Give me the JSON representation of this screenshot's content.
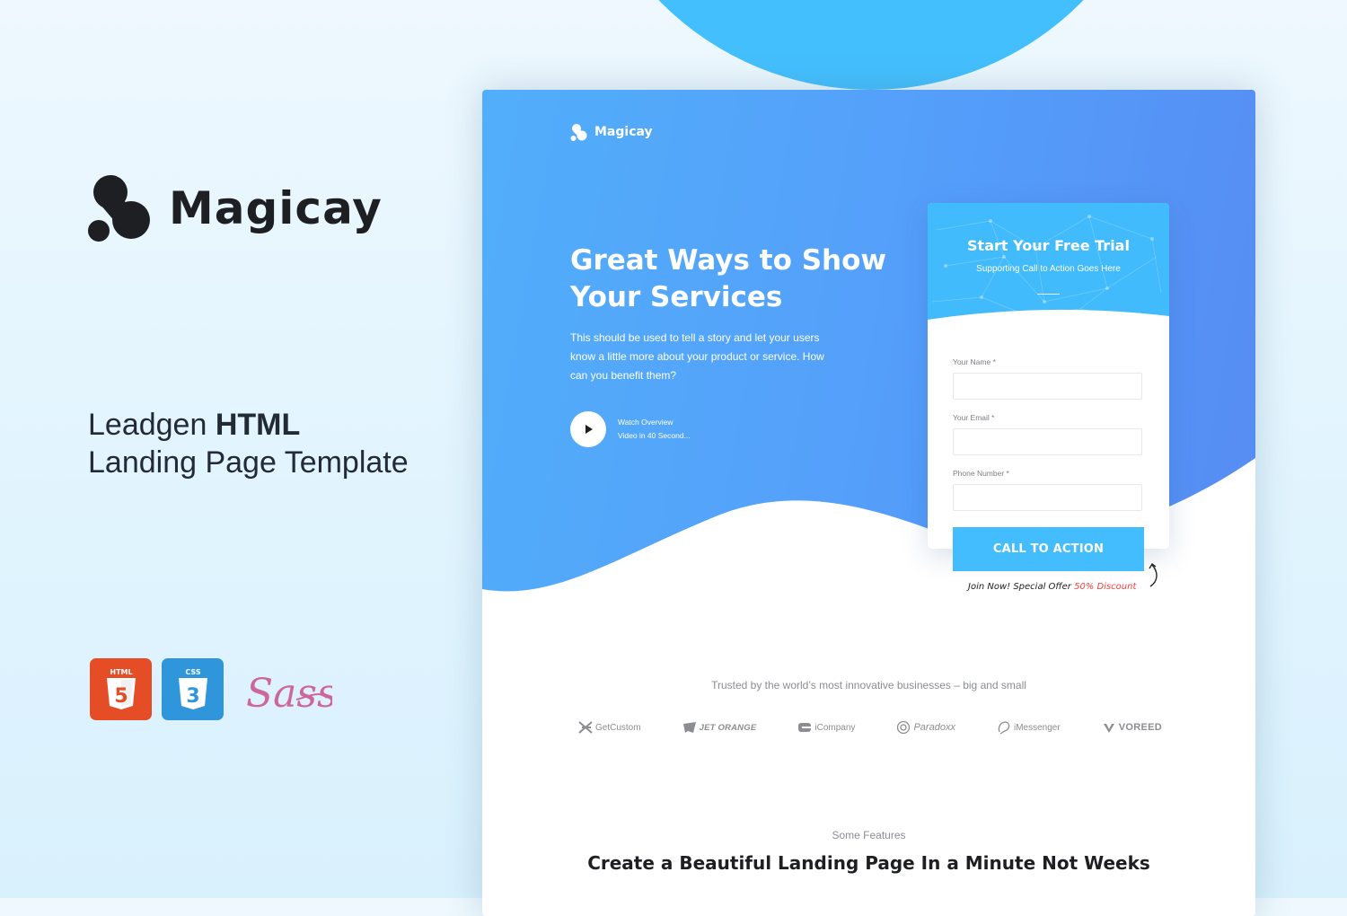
{
  "promo": {
    "brand_name": "Magicay",
    "tagline_light": "Leadgen ",
    "tagline_bold": "HTML",
    "tagline_line2": "Landing Page Template",
    "tech_badges": [
      {
        "name": "html5-logo",
        "label": "HTML",
        "number": "5"
      },
      {
        "name": "css3-logo",
        "label": "CSS",
        "number": "3"
      },
      {
        "name": "sass-logo",
        "label": "Sass"
      }
    ]
  },
  "preview": {
    "brand_name": "Magicay",
    "hero": {
      "title": "Great Ways to Show Your Services",
      "text": "This should be used to tell a story and let your users know a little more about your product or service. How can you benefit them?",
      "watch_line1": "Watch Overview",
      "watch_line2": "Video in 40 Second..."
    },
    "form": {
      "title": "Start Your Free Trial",
      "subtitle": "Supporting Call to Action Goes Here",
      "fields": [
        {
          "label": "Your Name *",
          "value": "",
          "placeholder": ""
        },
        {
          "label": "Your Email *",
          "value": "",
          "placeholder": ""
        },
        {
          "label": "Phone Number *",
          "value": "",
          "placeholder": ""
        }
      ],
      "cta_label": "CALL TO ACTION",
      "offer_text": "Join Now! Special Offer ",
      "offer_discount": "50% Discount"
    },
    "trusted_text": "Trusted by the world’s most innovative businesses – big and small",
    "logos": [
      "GetCustom",
      "JET ORANGE",
      "iCompany",
      "Paradoxx",
      "iMessenger",
      "VOREED"
    ],
    "features_kicker": "Some Features",
    "features_title": "Create a Beautiful Landing Page In a Minute Not Weeks"
  },
  "colors": {
    "accent": "#43bdfd",
    "hero_start": "#52aefa",
    "hero_end": "#568cf3",
    "discount": "#f4413c",
    "html_badge": "#e44d26",
    "css_badge": "#2f96db",
    "sass": "#cd6799"
  }
}
